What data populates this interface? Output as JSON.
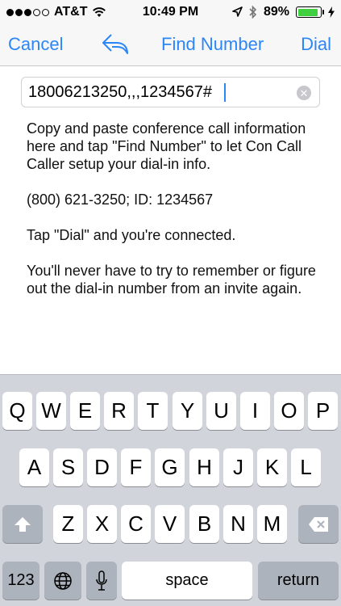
{
  "status_bar": {
    "carrier": "AT&T",
    "time": "10:49 PM",
    "battery_percent": "89%",
    "battery_level": 0.89,
    "signal_bars_filled": 3,
    "signal_bars_total": 5,
    "icons": [
      "wifi-icon",
      "location-arrow-icon",
      "bluetooth-icon",
      "battery-icon",
      "charging-bolt-icon"
    ]
  },
  "nav": {
    "cancel_label": "Cancel",
    "undo_icon": "undo-arrow-icon",
    "find_label": "Find Number",
    "dial_label": "Dial",
    "accent_color": "#2b86f7"
  },
  "input": {
    "value": "18006213250,,,1234567#",
    "clear_icon": "clear-circle-icon"
  },
  "instructions": {
    "p1": "Copy and paste conference call information here and tap \"Find Number\" to let Con Call Caller setup your dial-in info.",
    "p2": "(800) 621-3250;  ID: 1234567",
    "p3": "Tap \"Dial\" and you're connected.",
    "p4": "You'll never have to try to remember or figure out the dial-in number from an invite again."
  },
  "keyboard": {
    "row1": [
      "Q",
      "W",
      "E",
      "R",
      "T",
      "Y",
      "U",
      "I",
      "O",
      "P"
    ],
    "row2": [
      "A",
      "S",
      "D",
      "F",
      "G",
      "H",
      "J",
      "K",
      "L"
    ],
    "row3": [
      "Z",
      "X",
      "C",
      "V",
      "B",
      "N",
      "M"
    ],
    "numbers_label": "123",
    "space_label": "space",
    "return_label": "return",
    "shift_icon": "shift-arrow-icon",
    "delete_icon": "backspace-icon",
    "globe_icon": "globe-icon",
    "mic_icon": "microphone-icon"
  }
}
